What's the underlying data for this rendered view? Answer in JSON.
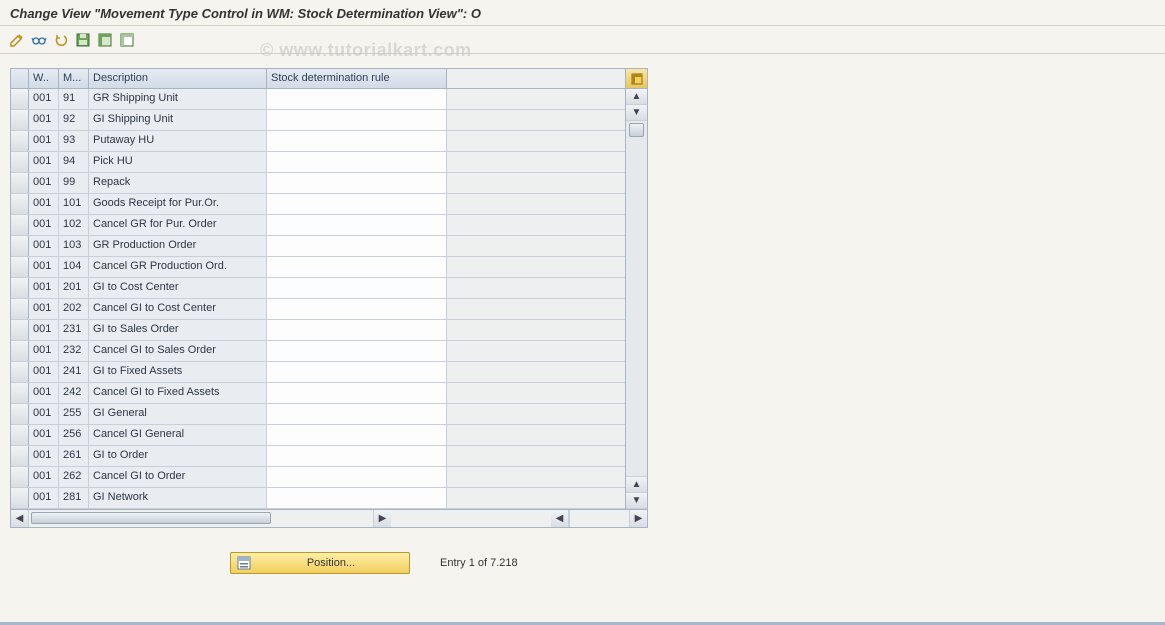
{
  "title": "Change View \"Movement Type Control in WM: Stock Determination View\": O",
  "watermark": "© www.tutorialkart.com",
  "columns": {
    "w": "W..",
    "m": "M...",
    "desc": "Description",
    "rule": "Stock determination rule"
  },
  "rows": [
    {
      "w": "001",
      "m": "91",
      "desc": "GR Shipping Unit",
      "rule": ""
    },
    {
      "w": "001",
      "m": "92",
      "desc": "GI Shipping Unit",
      "rule": ""
    },
    {
      "w": "001",
      "m": "93",
      "desc": "Putaway HU",
      "rule": ""
    },
    {
      "w": "001",
      "m": "94",
      "desc": "Pick HU",
      "rule": ""
    },
    {
      "w": "001",
      "m": "99",
      "desc": "Repack",
      "rule": ""
    },
    {
      "w": "001",
      "m": "101",
      "desc": "Goods Receipt for Pur.Or.",
      "rule": ""
    },
    {
      "w": "001",
      "m": "102",
      "desc": "Cancel GR for Pur. Order",
      "rule": ""
    },
    {
      "w": "001",
      "m": "103",
      "desc": "GR Production Order",
      "rule": ""
    },
    {
      "w": "001",
      "m": "104",
      "desc": "Cancel GR Production Ord.",
      "rule": ""
    },
    {
      "w": "001",
      "m": "201",
      "desc": "GI to Cost Center",
      "rule": ""
    },
    {
      "w": "001",
      "m": "202",
      "desc": "Cancel GI to Cost Center",
      "rule": ""
    },
    {
      "w": "001",
      "m": "231",
      "desc": "GI to Sales Order",
      "rule": ""
    },
    {
      "w": "001",
      "m": "232",
      "desc": "Cancel GI to Sales Order",
      "rule": ""
    },
    {
      "w": "001",
      "m": "241",
      "desc": "GI to Fixed Assets",
      "rule": ""
    },
    {
      "w": "001",
      "m": "242",
      "desc": "Cancel GI to Fixed Assets",
      "rule": ""
    },
    {
      "w": "001",
      "m": "255",
      "desc": "GI General",
      "rule": ""
    },
    {
      "w": "001",
      "m": "256",
      "desc": "Cancel GI General",
      "rule": ""
    },
    {
      "w": "001",
      "m": "261",
      "desc": "GI to Order",
      "rule": ""
    },
    {
      "w": "001",
      "m": "262",
      "desc": "Cancel GI to Order",
      "rule": ""
    },
    {
      "w": "001",
      "m": "281",
      "desc": "GI Network",
      "rule": ""
    }
  ],
  "position_button": "Position...",
  "entry_status": "Entry 1 of 7.218",
  "toolbar_icons": [
    "change-icon",
    "glasses-icon",
    "undo-icon",
    "save-icon",
    "select-all-icon",
    "deselect-all-icon"
  ]
}
